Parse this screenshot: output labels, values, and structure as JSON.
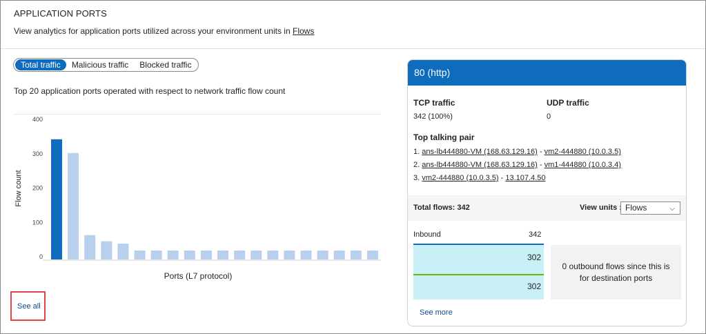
{
  "header": {
    "title": "APPLICATION PORTS",
    "subtitle_text": "View analytics for application ports utilized across your environment units in ",
    "subtitle_link": "Flows"
  },
  "tabs": [
    {
      "label": "Total traffic",
      "active": true
    },
    {
      "label": "Malicious traffic",
      "active": false
    },
    {
      "label": "Blocked traffic",
      "active": false
    }
  ],
  "chart_description": "Top 20 application ports operated with respect to network traffic flow count",
  "chart_data": {
    "type": "bar",
    "xlabel": "Ports (L7 protocol)",
    "ylabel": "Flow count",
    "ylim": [
      0,
      400
    ],
    "yticks": [
      0,
      100,
      200,
      300,
      400
    ],
    "values": [
      342,
      302,
      63,
      45,
      38,
      18,
      18,
      18,
      18,
      18,
      18,
      18,
      18,
      18,
      18,
      18,
      18,
      18,
      18,
      18
    ],
    "selected_index": 0,
    "colors": {
      "selected": "#0f6cbd",
      "default": "#b8d0ec"
    }
  },
  "see_all": "See all",
  "card": {
    "title": "80 (http)",
    "tcp_label": "TCP traffic",
    "tcp_value": "342 (100%)",
    "udp_label": "UDP traffic",
    "udp_value": "0",
    "top_pair_label": "Top talking pair",
    "pairs": [
      {
        "num": "1.",
        "a": "ans-lb444880-VM (168.63.129.16)",
        "b": "vm2-444880 (10.0.3.5)"
      },
      {
        "num": "2.",
        "a": "ans-lb444880-VM (168.63.129.16)",
        "b": "vm1-444880 (10.0.3.4)"
      },
      {
        "num": "3.",
        "a": "vm2-444880 (10.0.3.5)",
        "b": "13.107.4.50"
      }
    ],
    "total_flows": "Total flows: 342",
    "view_units_label": "View units :",
    "view_units_value": "Flows",
    "inbound_label": "Inbound",
    "inbound_value": "342",
    "inbound_bar1": "302",
    "inbound_bar2": "302",
    "outbound_text": "0 outbound flows since this is for destination ports",
    "see_more": "See more"
  }
}
